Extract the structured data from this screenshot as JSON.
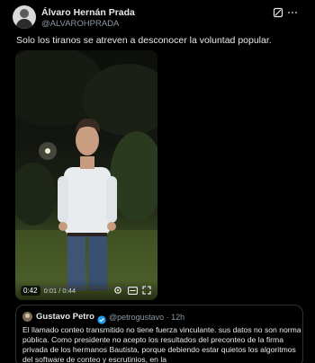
{
  "post": {
    "author_name": "Álvaro Hernán Prada",
    "author_handle": "@ALVAROHPRADA",
    "text": "Solo los tiranos se atreven a desconocer la voluntad popular."
  },
  "video": {
    "remaining_time": "0:42",
    "current_and_total": "0:01 / 0:44",
    "progress_fraction": 0.02
  },
  "quoted_post": {
    "author_name": "Gustavo Petro",
    "meta": "@petrogustavo · 12h",
    "text": "El llamado conteo transmitido no tiene fuerza vinculante. sus datos no son norma pública. Como presidente no acepto los resultados del preconteo de la firma privada  de los hermanos Bautista, porque debiendo estar quietos los algoritmos del software de conteo y escrutinios, en la"
  },
  "colors": {
    "background": "#000000",
    "text_primary": "#e7e9ea",
    "text_secondary": "#8b98a5",
    "border": "#2f3336",
    "verified_blue": "#1d9bf0"
  },
  "icons": [
    "avatar",
    "grok-icon",
    "more-icon",
    "settings-icon",
    "captions-icon",
    "fullscreen-icon",
    "verified-badge-icon"
  ]
}
